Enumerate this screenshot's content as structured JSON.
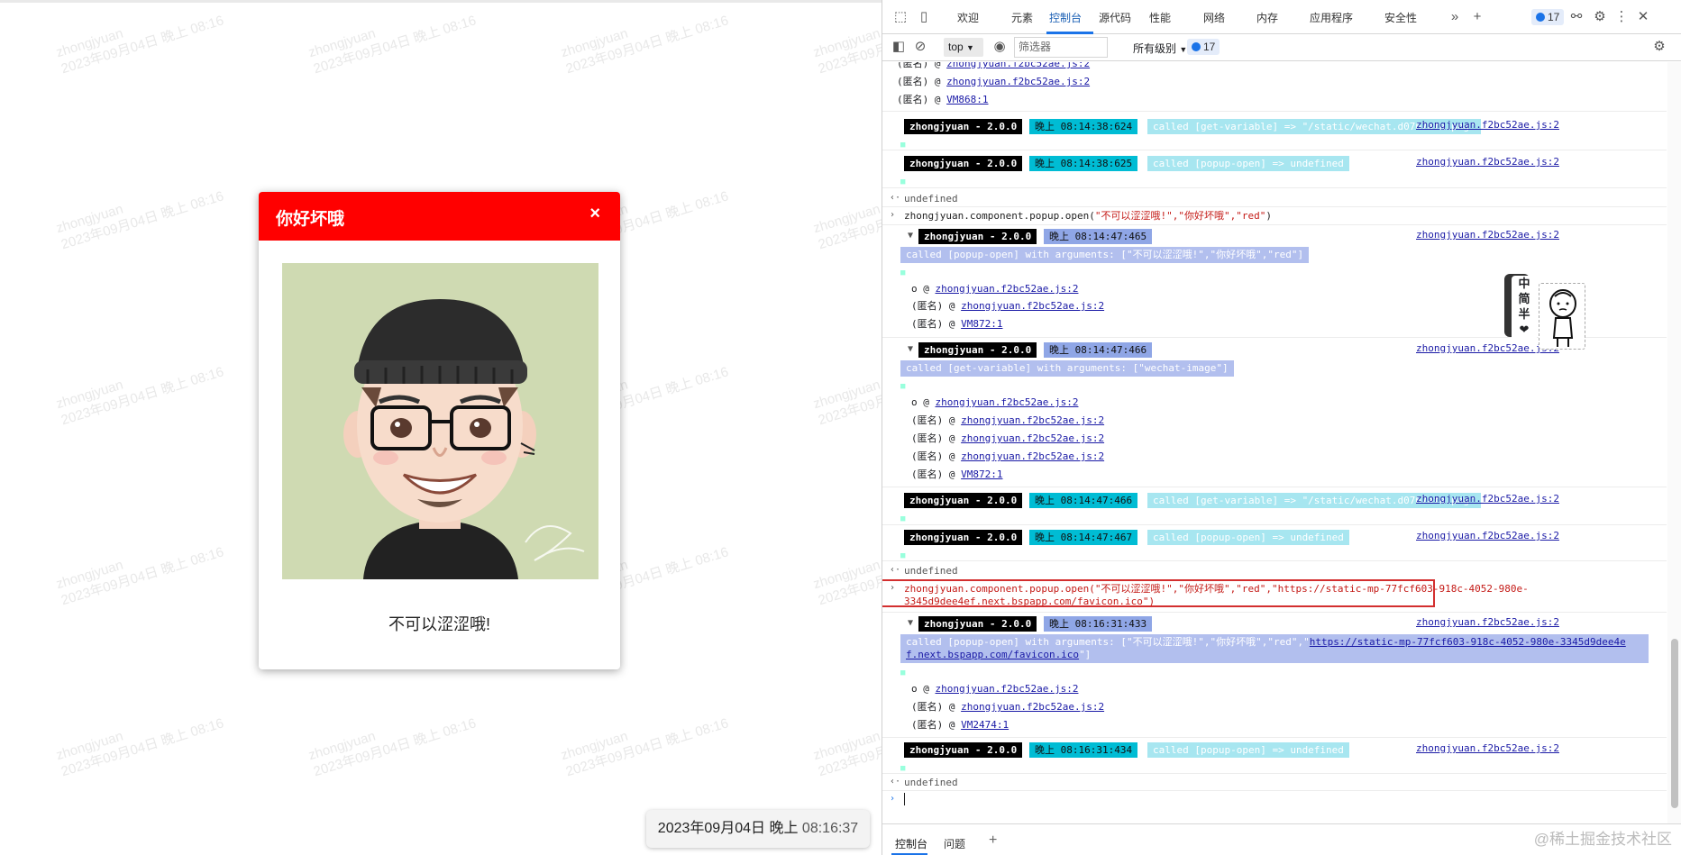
{
  "left": {
    "watermark": {
      "name": "zhongjyuan",
      "datetime": "2023年09月04日 晚上 08:16"
    },
    "popup": {
      "title": "你好坏哦",
      "close_glyph": "×",
      "message": "不可以涩涩哦!",
      "header_color": "#ff0000",
      "image_background": "#cfdab2"
    },
    "time_badge": {
      "date": "2023年09月04日",
      "period": "晚上",
      "time": "08:16:37"
    }
  },
  "devtools": {
    "tabs": [
      "欢迎",
      "元素",
      "控制台",
      "源代码",
      "性能",
      "网络",
      "内存",
      "应用程序",
      "安全性"
    ],
    "active_tab": "控制台",
    "issues_count": "17",
    "context": "top",
    "filter_placeholder": "筛选器",
    "levels": "所有级别",
    "levels_count": "17",
    "bottom_tabs": [
      "控制台",
      "问题"
    ],
    "console": {
      "anon": "(匿名) @",
      "o_at": "o      @",
      "src": "zhongjyuan.f2bc52ae.js:2",
      "vm868": "VM868:1",
      "vm872": "VM872:1",
      "vm2474": "VM2474:1",
      "name_tag": "zhongjyuan - 2.0.0",
      "undefined": "undefined",
      "period": "晚上",
      "t1": "08:14:38:624",
      "t2": "08:14:38:625",
      "t3": "08:14:47:465",
      "t4": "08:14:47:466",
      "t5": "08:14:47:466",
      "t6": "08:14:47:467",
      "t7": "08:16:31:433",
      "t8": "08:16:31:434",
      "msg_getvar_result": "called [get-variable] => \"/static/wechat.d0767afa.png\"",
      "msg_popup_result": "called [popup-open] => undefined",
      "cmd1_prefix": "zhongjyuan.component.popup.open(",
      "cmd1_args": "\"不可以涩涩哦!\",\"你好坏哦\",\"red\"",
      "cmd1_suffix": ")",
      "msg_popup_args1": "called [popup-open] with arguments: [\"不可以涩涩哦!\",\"你好坏哦\",\"red\"]",
      "msg_getvar_args": "called [get-variable] with arguments: [\"wechat-image\"]",
      "cmd2_line1": "zhongjyuan.component.popup.open(\"不可以涩涩哦!\",\"你好坏哦\",\"red\",\"https://static-mp-77fcf603-918c-4052-980e-",
      "cmd2_line2": "3345d9dee4ef.next.bspapp.com/favicon.ico\")",
      "msg_popup_args2_a": "called [popup-open] with arguments: [\"不可以涩涩哦!\",\"你好坏哦\",\"red\",\"",
      "msg_popup_args2_link1": "https://static-mp-77fcf603-918c-4052-980e-3345d9dee4e",
      "msg_popup_args2_link2": "f.next.bspapp.com/favicon.ico",
      "msg_popup_args2_end": "\"]"
    },
    "sticker_text": [
      "中",
      "简",
      "半"
    ]
  },
  "corner_watermark": "@稀土掘金技术社区"
}
